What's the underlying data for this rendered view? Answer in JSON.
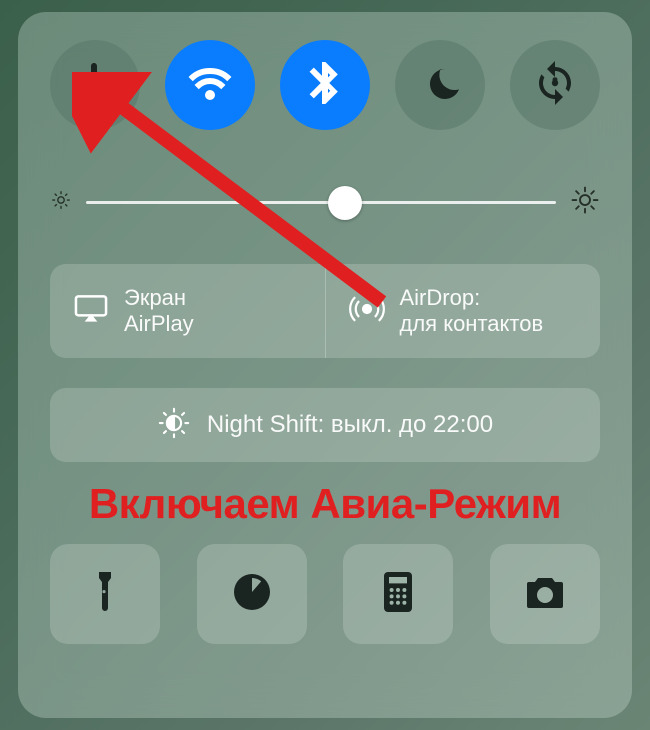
{
  "toggles": {
    "airplane": {
      "active": false
    },
    "wifi": {
      "active": true
    },
    "bluetooth": {
      "active": true
    },
    "dnd": {
      "active": false
    },
    "rotation_lock": {
      "active": false
    }
  },
  "brightness": {
    "value_percent": 55
  },
  "airplay": {
    "line1": "Экран",
    "line2": "AirPlay"
  },
  "airdrop": {
    "line1": "AirDrop:",
    "line2": "для контактов"
  },
  "nightshift": {
    "label": "Night Shift: выкл. до 22:00"
  },
  "annotation": {
    "text": "Включаем Авиа-Режим",
    "color": "#e02020"
  },
  "shortcuts": [
    "flashlight",
    "timer",
    "calculator",
    "camera"
  ]
}
